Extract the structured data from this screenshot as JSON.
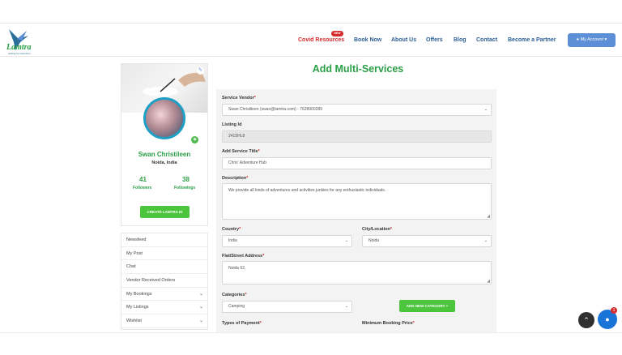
{
  "header": {
    "logo_text": "Lamtra",
    "logo_tagline": "waiting for adventure",
    "nav": [
      "Covid Resources",
      "Book Now",
      "About Us",
      "Offers",
      "Blog",
      "Contact",
      "Become a Partner"
    ],
    "new_badge": "NEW",
    "account_label": "My Account"
  },
  "profile": {
    "name": "Swan Christileen",
    "location": "Noida, India",
    "followers_count": "41",
    "followers_label": "Followers",
    "followings_count": "38",
    "followings_label": "Followings",
    "create_button": "CREATE LAMTRA ID"
  },
  "sidebar_menu": [
    "Newsfeed",
    "My Post",
    "Chat",
    "Vendor Received Orders",
    "My Bookings",
    "My Listings",
    "Wishlist"
  ],
  "page_title": "Add Multi-Services",
  "form": {
    "service_vendor_label": "Service Vendor",
    "service_vendor_value": "Swan Christileen (swan@lamtra.com) - 7628900289",
    "listing_id_label": "Listing Id",
    "listing_id_value": "2415HL8",
    "service_title_label": "Add Service Title",
    "service_title_value": "Chris' Adventure Hub",
    "description_label": "Description",
    "description_value": "We provide all kinds of adventures and activities junkies for any enthusiastic individuals.",
    "country_label": "Country",
    "country_value": "India",
    "city_label": "City/Location",
    "city_value": "Noida",
    "address_label": "Flat/Street Address",
    "address_value": "Noida 62,",
    "categories_label": "Categories",
    "categories_value": "Camping",
    "add_category_button": "ADD NEW CATEGORY +",
    "payment_label": "Types of Payment",
    "min_price_label": "Minimum Booking Price",
    "required_mark": "*"
  },
  "widgets": {
    "chat_badge": "1"
  },
  "colors": {
    "brand_green": "#2aa046",
    "nav_blue": "#2a5e94",
    "covid_red": "#d62b2b",
    "button_green": "#4cc43c",
    "account_blue": "#5c8fd6"
  }
}
